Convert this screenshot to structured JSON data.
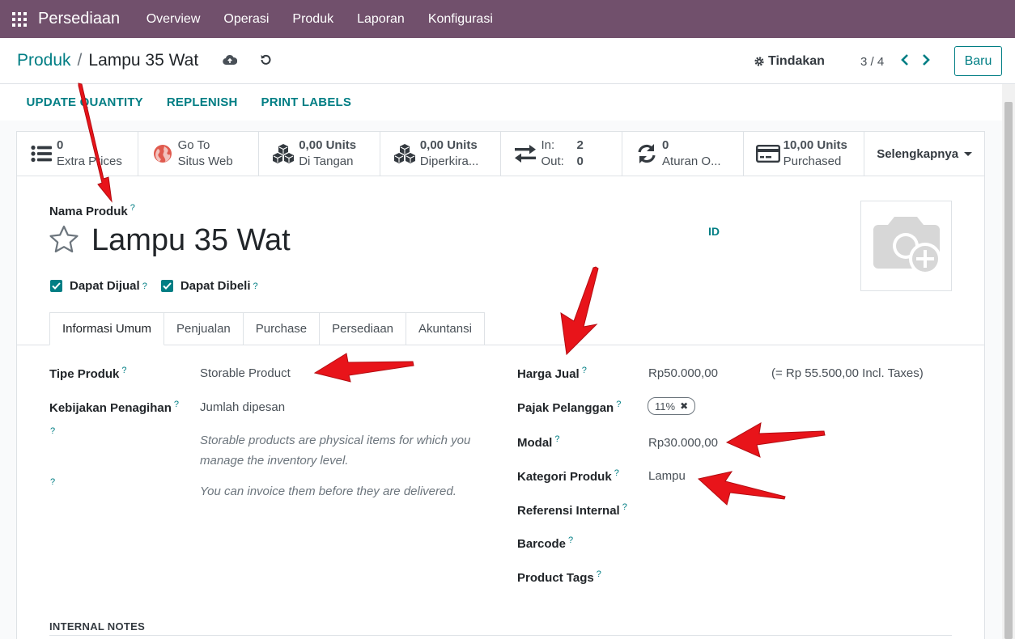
{
  "navbar": {
    "brand": "Persediaan",
    "items": [
      "Overview",
      "Operasi",
      "Produk",
      "Laporan",
      "Konfigurasi"
    ]
  },
  "breadcrumb": {
    "parent": "Produk",
    "separator": "/",
    "current": "Lampu 35 Wat"
  },
  "control": {
    "actions_label": "Tindakan",
    "pager": "3 / 4",
    "new_label": "Baru"
  },
  "action_buttons": [
    "UPDATE QUANTITY",
    "REPLENISH",
    "PRINT LABELS"
  ],
  "smart_buttons": {
    "extra_prices": {
      "value": "0",
      "label": "Extra Prices"
    },
    "website": {
      "value": "Go To",
      "label": "Situs Web"
    },
    "on_hand": {
      "value": "0,00 Units",
      "label": "Di Tangan"
    },
    "forecasted": {
      "value": "0,00 Units",
      "label": "Diperkira..."
    },
    "moves": {
      "in_label": "In:",
      "in_value": "2",
      "out_label": "Out:",
      "out_value": "0"
    },
    "rules": {
      "value": "0",
      "label": "Aturan O..."
    },
    "purchased": {
      "value": "10,00 Units",
      "label": "Purchased"
    },
    "more": "Selengkapnya"
  },
  "product": {
    "name_label": "Nama Produk",
    "name": "Lampu 35 Wat",
    "lang": "ID",
    "can_sell_label": "Dapat Dijual",
    "can_purchase_label": "Dapat Dibeli"
  },
  "tabs": [
    "Informasi Umum",
    "Penjualan",
    "Purchase",
    "Persediaan",
    "Akuntansi"
  ],
  "general": {
    "type_label": "Tipe Produk",
    "type_value": "Storable Product",
    "invoice_policy_label": "Kebijakan Penagihan",
    "invoice_policy_value": "Jumlah dipesan",
    "help_1": "Storable products are physical items for which you manage the inventory level.",
    "help_2": "You can invoice them before they are delivered.",
    "sales_price_label": "Harga Jual",
    "sales_price_value": "Rp50.000,00",
    "sales_price_incl": "(= Rp 55.500,00 Incl. Taxes)",
    "customer_taxes_label": "Pajak Pelanggan",
    "customer_tax_tag": "11%",
    "cost_label": "Modal",
    "cost_value": "Rp30.000,00",
    "category_label": "Kategori Produk",
    "category_value": "Lampu",
    "internal_ref_label": "Referensi Internal",
    "barcode_label": "Barcode",
    "tags_label": "Product Tags",
    "help_mark": "?"
  },
  "internal_notes_label": "INTERNAL NOTES",
  "colors": {
    "navbar": "#71506c",
    "accent": "#017e84",
    "annotation_arrow": "#e8141a"
  }
}
